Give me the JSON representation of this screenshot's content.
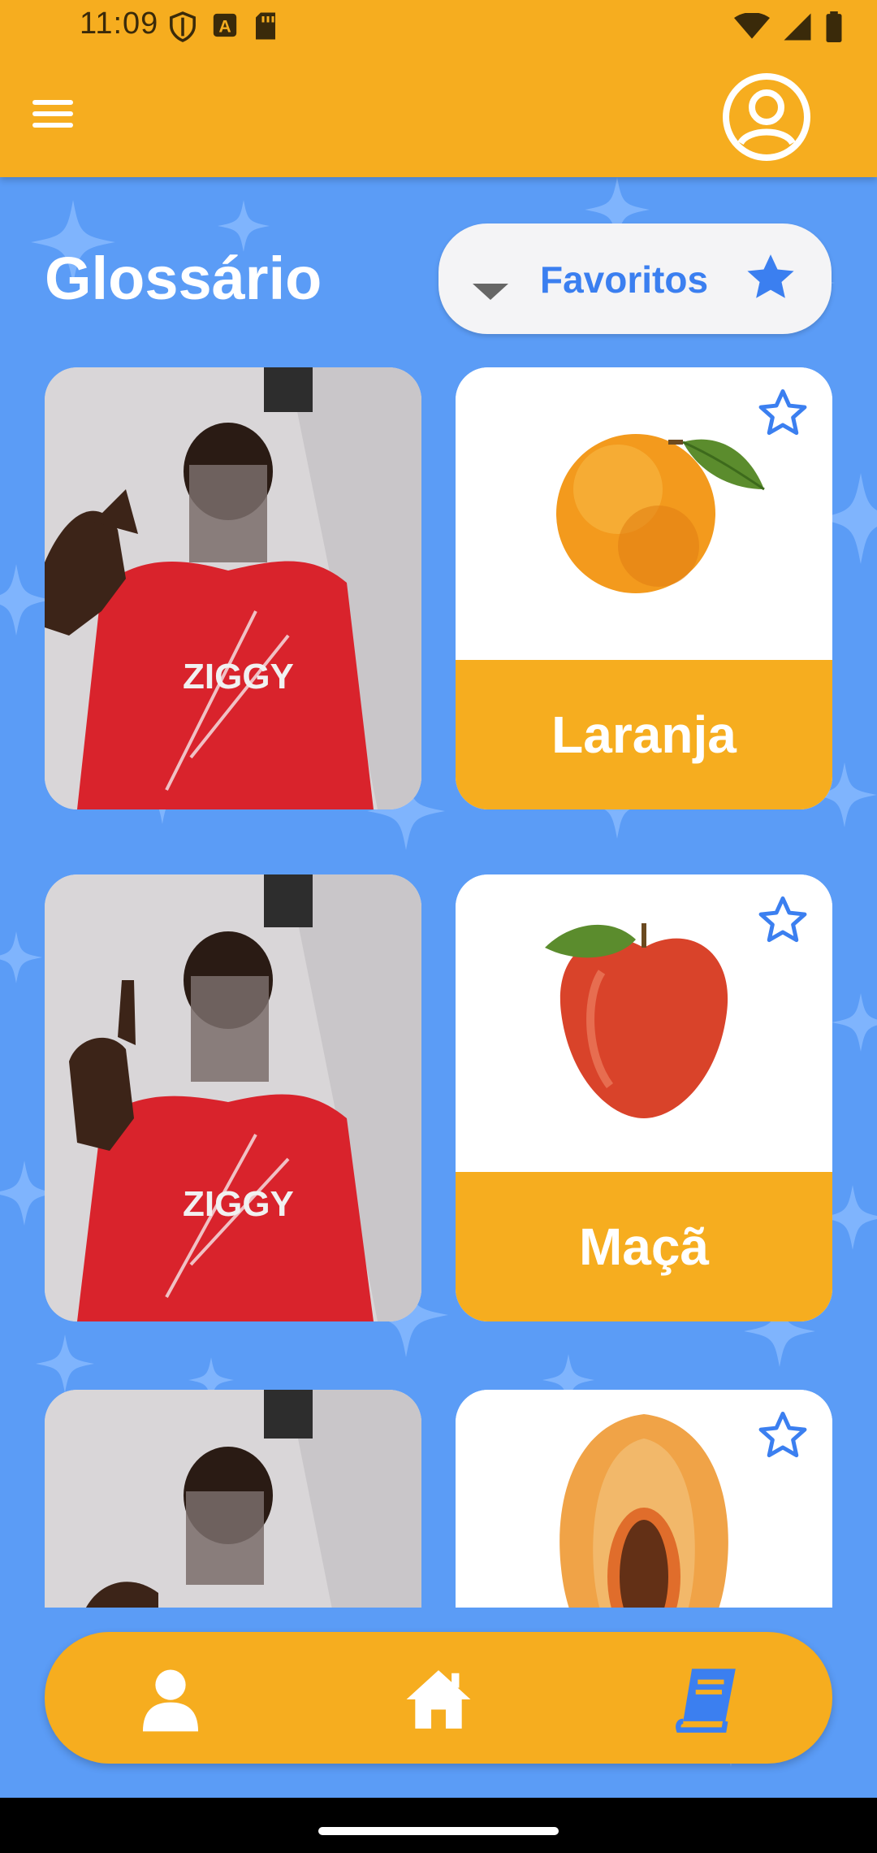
{
  "status_bar": {
    "time": "11:09",
    "icons_left": [
      "shield-icon",
      "font-icon",
      "sd-card-icon"
    ],
    "icons_right": [
      "wifi-icon",
      "signal-icon",
      "battery-icon"
    ]
  },
  "app_bar": {
    "menu_icon": "menu-icon",
    "profile_icon": "account-circle-icon"
  },
  "header": {
    "title": "Glossário",
    "filter": {
      "label": "Favoritos",
      "caret_icon": "caret-down-icon",
      "star_icon": "star-filled-icon"
    }
  },
  "items": [
    {
      "word": "Laranja",
      "favorite": false
    },
    {
      "word": "Maçã",
      "favorite": false
    },
    {
      "word": "",
      "favorite": false
    }
  ],
  "bottom_nav": [
    {
      "icon": "person-icon",
      "active": false
    },
    {
      "icon": "home-icon",
      "active": false
    },
    {
      "icon": "book-icon",
      "active": true
    }
  ],
  "colors": {
    "primary_orange": "#f6ad1f",
    "background_blue": "#5b9cf6",
    "accent_blue": "#3b7ff0",
    "white": "#ffffff"
  }
}
